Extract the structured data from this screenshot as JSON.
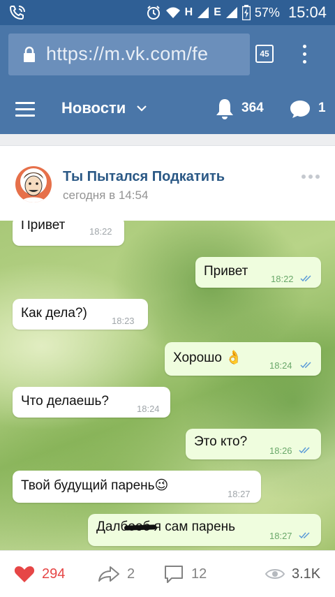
{
  "status_bar": {
    "network_h": "H",
    "network_e": "E",
    "battery": "57%",
    "time": "15:04"
  },
  "browser": {
    "url": "https://m.vk.com/fe",
    "tab_count": "45"
  },
  "nav": {
    "title": "Новости",
    "notifications_count": "364",
    "messages_count": "1"
  },
  "post": {
    "author": "Ты Пытался Подкатить",
    "time": "сегодня в 14:54"
  },
  "chat": {
    "messages": [
      {
        "text": "Привет",
        "time": "18:22",
        "direction": "in"
      },
      {
        "text": "Привет",
        "time": "18:22",
        "direction": "out"
      },
      {
        "text": "Как дела?)",
        "time": "18:23",
        "direction": "in"
      },
      {
        "text": "Хорошо 👌",
        "time": "18:24",
        "direction": "out"
      },
      {
        "text": "Что делаешь?",
        "time": "18:24",
        "direction": "in"
      },
      {
        "text": "Это кто?",
        "time": "18:26",
        "direction": "out"
      },
      {
        "text": "Твой будущий парень😉",
        "time": "18:27",
        "direction": "in"
      },
      {
        "text": "Далбооб я сам парень",
        "time": "18:27",
        "direction": "out"
      }
    ]
  },
  "actions": {
    "likes": "294",
    "shares": "2",
    "comments": "12",
    "views": "3.1K"
  },
  "colors": {
    "vk_blue": "#4a76a8",
    "status_blue": "#2f5f95",
    "like_red": "#e64646",
    "link_blue": "#2a5885"
  }
}
